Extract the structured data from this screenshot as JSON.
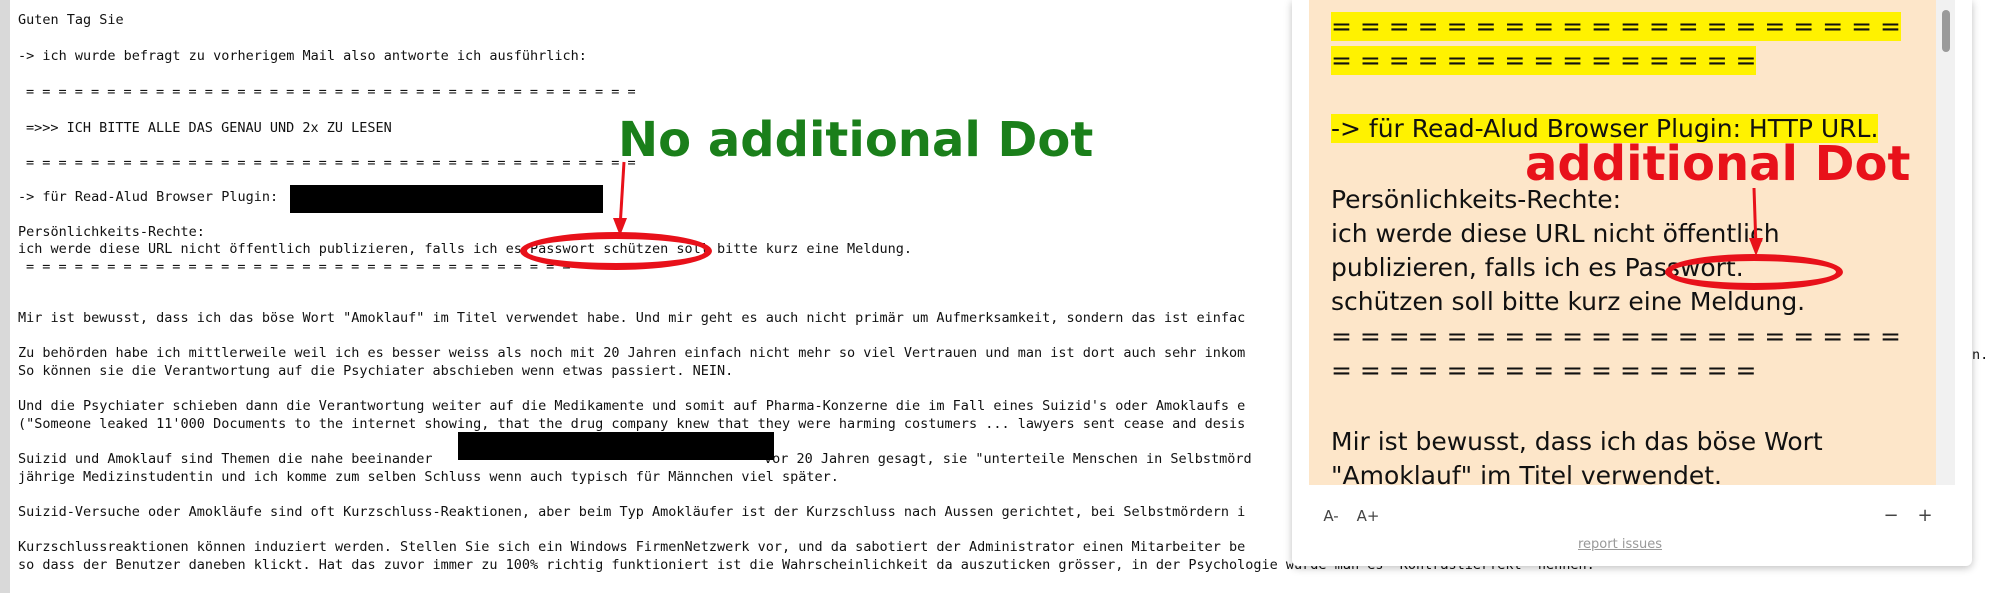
{
  "email": {
    "greeting": "Guten Tag Sie",
    "line_reply": "-> ich wurde befragt zu vorherigem Mail also antworte ich ausführlich:",
    "separator": "= = = = = = = = = = = = = = = = = = = = = = = = = = = = = = = = = = = = = =",
    "line_please": "=>>> ICH BITTE ALLE DAS GENAU UND 2x ZU LESEN",
    "separator2": "= = = = = = = = = = = = = = = = = = = = = = = = = = = = = = = = = = = = = =",
    "line_plugin": "-> für Read-Alud Browser Plugin:",
    "line_rights_title": "Persönlichkeits-Rechte:",
    "line_rights_body": "ich werde diese URL nicht öffentlich publizieren, falls ich es Passwort schützen soll bitte kurz eine Meldung.",
    "separator3": "= = = = = = = = = = = = = = = = = = = = = = = = = = = = = = = = = = = = = =",
    "para1": "Mir ist bewusst, dass ich das böse Wort \"Amoklauf\" im Titel verwendet habe. Und mir geht es auch nicht primär um Aufmerksamkeit, sondern das ist einfac",
    "para2a": "Zu behörden habe ich mittlerweile weil ich es besser weiss als noch mit 20 Jahren einfach nicht mehr so viel Vertrauen und man ist dort auch sehr inkom",
    "para2b": "So können sie die Verantwortung auf die Psychiater abschieben wenn etwas passiert. NEIN.",
    "para3a": "Und die Psychiater schieben dann die Verantwortung weiter auf die Medikamente und somit auf Pharma-Konzerne die im Fall eines Suizid's oder Amoklaufs e",
    "para3b": "(\"Someone leaked 11'000 Documents to the internet showing, that the drug company knew that they were harming costumers ... lawyers sent cease and desis",
    "para4a": "Suizid und Amoklauf sind Themen die nahe beeinander",
    "para4a_rest": "vor 20 Jahren gesagt, sie \"unterteile Menschen in Selbstmörd",
    "para4b": "jährige Medizinstudentin und ich komme zum selben Schluss wenn auch typisch für Männchen viel später.",
    "para5": "Suizid-Versuche oder Amokläufe sind oft Kurzschluss-Reaktionen, aber beim Typ Amokläufer ist der Kurzschluss nach Aussen gerichtet, bei Selbstmördern i",
    "para6a": "Kurzschlussreaktionen können induziert werden. Stellen Sie sich ein Windows FirmenNetzwerk vor, und da sabotiert der Administrator einen Mitarbeiter be",
    "para6b": "so dass der Benutzer daneben klickt. Hat das zuvor immer zu 100% richtig funktioniert ist die Wahrscheinlichkeit da auszuticken grösser, in der Psychologie würde man es \"Kontrastierfekt\" nennen.",
    "right_edge_text": "n."
  },
  "annotations": {
    "no_dot": "No additional Dot",
    "additional_dot": "additional Dot"
  },
  "reader": {
    "sep_a": "= = = = = = = = = = = = = = = = = = = =",
    "sep_b": "= = = = = = = = = = = = = = =",
    "plugin_line": "-> für Read-Alud Browser Plugin: HTTP URL.",
    "rights_title": "Persönlichkeits-Rechte:",
    "rights_1": "ich werde diese URL nicht öffentlich",
    "rights_2": "publizieren, falls ich es Passwort.",
    "rights_3": "schützen soll bitte kurz eine Meldung.",
    "sep_c": "= = = = = = = = = = = = = = = = = = = =",
    "sep_d": "= = = = = = = = = = = = = = =",
    "para_1": "Mir ist bewusst, dass ich das böse Wort",
    "para_2": "\"Amoklauf\" im Titel verwendet."
  },
  "controls": {
    "font_smaller": "A-",
    "font_larger": "A+",
    "minus": "−",
    "plus": "+",
    "report": "report issues"
  },
  "colors": {
    "highlight": "#fff200",
    "reader_bg": "#fde6c9",
    "annotation_red": "#e8111a",
    "annotation_green": "#1a7f1a"
  }
}
